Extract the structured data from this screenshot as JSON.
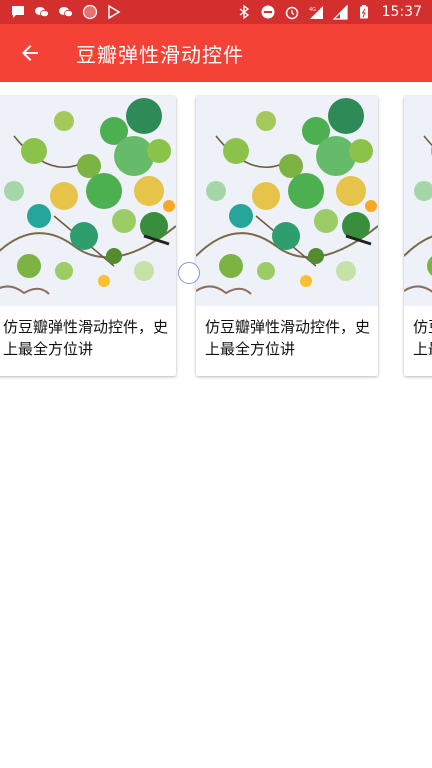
{
  "statusbar": {
    "time": "15:37",
    "network": "4G",
    "left_icons": [
      "chat-bubble-icon",
      "wechat-icon",
      "wechat-icon",
      "record-icon",
      "play-store-icon"
    ],
    "right_icons": [
      "bluetooth-icon",
      "do-not-disturb-icon",
      "alarm-icon",
      "signal-4g-icon",
      "signal-icon",
      "battery-icon"
    ]
  },
  "toolbar": {
    "back_icon": "arrow-left-icon",
    "title": "豆瓣弹性滑动控件"
  },
  "cards": [
    {
      "text": "仿豆瓣弹性滑动控件，史上最全方位讲"
    },
    {
      "text": "仿豆瓣弹性滑动控件，史上最全方位讲"
    },
    {
      "text": "仿豆瓣弹性滑动控件，史上最全方位讲"
    }
  ],
  "colors": {
    "statusbar": "#d32f2f",
    "toolbar": "#f44336",
    "background": "#ffffff"
  }
}
